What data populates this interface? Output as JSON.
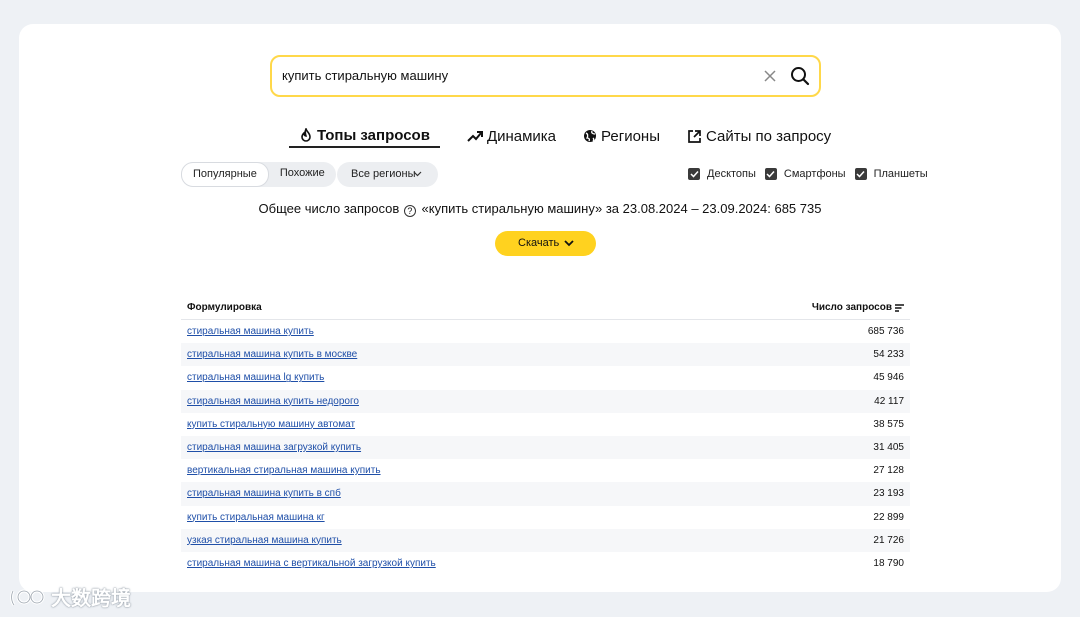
{
  "search": {
    "query": "купить стиральную машину"
  },
  "tabs": [
    {
      "label": "Топы запросов",
      "icon": "fire-icon"
    },
    {
      "label": "Динамика",
      "icon": "trend-icon"
    },
    {
      "label": "Регионы",
      "icon": "globe-icon"
    },
    {
      "label": "Сайты по запросу",
      "icon": "external-link-icon"
    }
  ],
  "filters": {
    "segment": [
      "Популярные",
      "Похожие"
    ],
    "regions": "Все регионы",
    "devices": [
      "Десктопы",
      "Смартфоны",
      "Планшеты"
    ]
  },
  "summary": {
    "prefix": "Общее число запросов",
    "rest": "«купить стиральную машину» за 23.08.2024 – 23.09.2024: 685 735"
  },
  "download_label": "Скачать",
  "table": {
    "col_phrase": "Формулировка",
    "col_count": "Число запросов",
    "rows": [
      {
        "phrase": "стиральная машина купить",
        "count": "685 736"
      },
      {
        "phrase": "стиральная машина купить в москве",
        "count": "54 233"
      },
      {
        "phrase": "стиральная машина lg купить",
        "count": "45 946"
      },
      {
        "phrase": "стиральная машина купить недорого",
        "count": "42 117"
      },
      {
        "phrase": "купить стиральную машину автомат",
        "count": "38 575"
      },
      {
        "phrase": "стиральная машина загрузкой купить",
        "count": "31 405"
      },
      {
        "phrase": "вертикальная стиральная машина купить",
        "count": "27 128"
      },
      {
        "phrase": "стиральная машина купить в спб",
        "count": "23 193"
      },
      {
        "phrase": "купить стиральная машина кг",
        "count": "22 899"
      },
      {
        "phrase": "узкая стиральная машина купить",
        "count": "21 726"
      },
      {
        "phrase": "стиральная машина с вертикальной загрузкой купить",
        "count": "18 790"
      }
    ]
  },
  "watermark": "大数跨境",
  "colors": {
    "accent": "#ffd21f",
    "link": "#1f4fa8",
    "page_bg": "#eef1f5"
  }
}
